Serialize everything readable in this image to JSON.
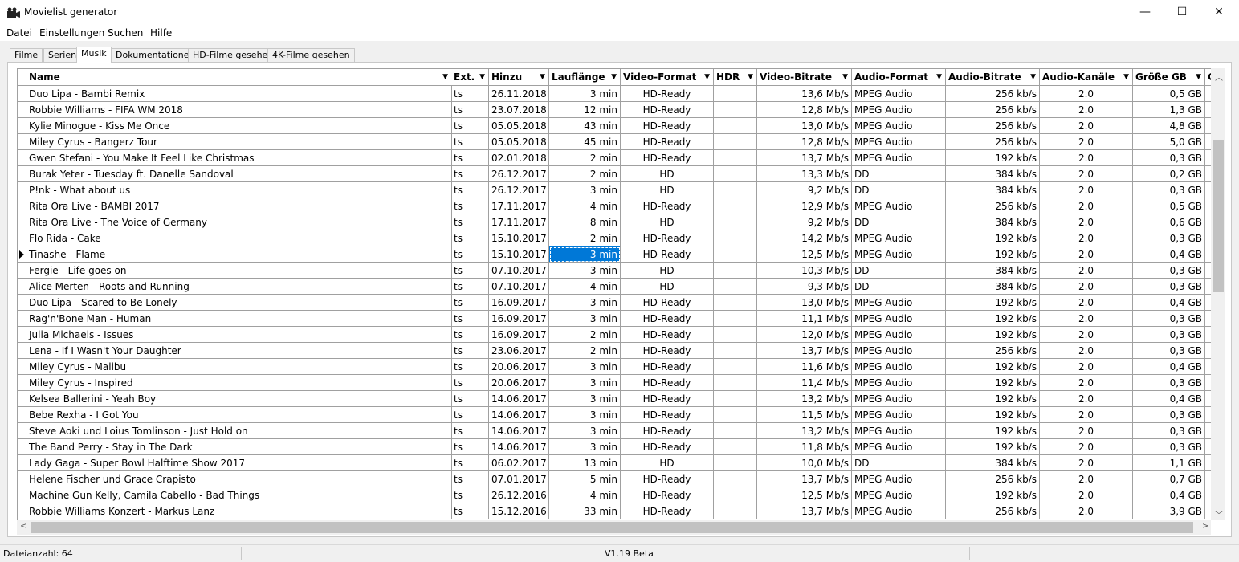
{
  "window": {
    "title": "Movielist generator",
    "minimize": "—",
    "maximize": "☐",
    "close": "✕"
  },
  "menu": [
    "Datei",
    "Einstellungen",
    "Suchen",
    "Hilfe"
  ],
  "tabs": [
    "Filme",
    "Serien",
    "Musik",
    "Dokumentationen",
    "HD-Filme gesehen",
    "4K-Filme gesehen"
  ],
  "active_tab": "Musik",
  "grid": {
    "columns": [
      "Name",
      "Ext.",
      "Hinzu",
      "Lauflänge",
      "Video-Format",
      "HDR",
      "Video-Bitrate",
      "Audio-Format",
      "Audio-Bitrate",
      "Audio-Kanäle",
      "Größe GB",
      "G"
    ],
    "rows": [
      [
        "Duo Lipa - Bambi Remix",
        "ts",
        "26.11.2018",
        "3 min",
        "HD-Ready",
        "",
        "13,6 Mb/s",
        "MPEG Audio",
        "256 kb/s",
        "2.0",
        "0,5 GB"
      ],
      [
        "Robbie Williams - FIFA WM 2018",
        "ts",
        "23.07.2018",
        "12 min",
        "HD-Ready",
        "",
        "12,8 Mb/s",
        "MPEG Audio",
        "256 kb/s",
        "2.0",
        "1,3 GB"
      ],
      [
        "Kylie Minogue - Kiss Me Once",
        "ts",
        "05.05.2018",
        "43 min",
        "HD-Ready",
        "",
        "13,0 Mb/s",
        "MPEG Audio",
        "256 kb/s",
        "2.0",
        "4,8 GB"
      ],
      [
        "Miley Cyrus - Bangerz Tour",
        "ts",
        "05.05.2018",
        "45 min",
        "HD-Ready",
        "",
        "12,8 Mb/s",
        "MPEG Audio",
        "256 kb/s",
        "2.0",
        "5,0 GB"
      ],
      [
        "Gwen Stefani - You Make It Feel Like Christmas",
        "ts",
        "02.01.2018",
        "2 min",
        "HD-Ready",
        "",
        "13,7 Mb/s",
        "MPEG Audio",
        "192 kb/s",
        "2.0",
        "0,3 GB"
      ],
      [
        "Burak Yeter - Tuesday ft. Danelle Sandoval",
        "ts",
        "26.12.2017",
        "2 min",
        "HD",
        "",
        "13,3 Mb/s",
        "DD",
        "384 kb/s",
        "2.0",
        "0,2 GB"
      ],
      [
        "P!nk - What about us",
        "ts",
        "26.12.2017",
        "3 min",
        "HD",
        "",
        "9,2 Mb/s",
        "DD",
        "384 kb/s",
        "2.0",
        "0,3 GB"
      ],
      [
        "Rita Ora Live - BAMBI 2017",
        "ts",
        "17.11.2017",
        "4 min",
        "HD-Ready",
        "",
        "12,9 Mb/s",
        "MPEG Audio",
        "256 kb/s",
        "2.0",
        "0,5 GB"
      ],
      [
        "Rita Ora Live - The Voice of Germany",
        "ts",
        "17.11.2017",
        "8 min",
        "HD",
        "",
        "9,2 Mb/s",
        "DD",
        "384 kb/s",
        "2.0",
        "0,6 GB"
      ],
      [
        "Flo Rida - Cake",
        "ts",
        "15.10.2017",
        "2 min",
        "HD-Ready",
        "",
        "14,2 Mb/s",
        "MPEG Audio",
        "192 kb/s",
        "2.0",
        "0,3 GB"
      ],
      [
        "Tinashe - Flame",
        "ts",
        "15.10.2017",
        "3 min",
        "HD-Ready",
        "",
        "12,5 Mb/s",
        "MPEG Audio",
        "192 kb/s",
        "2.0",
        "0,4 GB"
      ],
      [
        "Fergie - Life goes on",
        "ts",
        "07.10.2017",
        "3 min",
        "HD",
        "",
        "10,3 Mb/s",
        "DD",
        "384 kb/s",
        "2.0",
        "0,3 GB"
      ],
      [
        "Alice Merten - Roots and Running",
        "ts",
        "07.10.2017",
        "4 min",
        "HD",
        "",
        "9,3 Mb/s",
        "DD",
        "384 kb/s",
        "2.0",
        "0,3 GB"
      ],
      [
        "Duo Lipa - Scared to Be Lonely",
        "ts",
        "16.09.2017",
        "3 min",
        "HD-Ready",
        "",
        "13,0 Mb/s",
        "MPEG Audio",
        "192 kb/s",
        "2.0",
        "0,4 GB"
      ],
      [
        "Rag'n'Bone Man - Human",
        "ts",
        "16.09.2017",
        "3 min",
        "HD-Ready",
        "",
        "11,1 Mb/s",
        "MPEG Audio",
        "192 kb/s",
        "2.0",
        "0,3 GB"
      ],
      [
        "Julia Michaels - Issues",
        "ts",
        "16.09.2017",
        "2 min",
        "HD-Ready",
        "",
        "12,0 Mb/s",
        "MPEG Audio",
        "192 kb/s",
        "2.0",
        "0,3 GB"
      ],
      [
        "Lena - If I Wasn't Your Daughter",
        "ts",
        "23.06.2017",
        "2 min",
        "HD-Ready",
        "",
        "13,7 Mb/s",
        "MPEG Audio",
        "256 kb/s",
        "2.0",
        "0,3 GB"
      ],
      [
        "Miley Cyrus - Malibu",
        "ts",
        "20.06.2017",
        "3 min",
        "HD-Ready",
        "",
        "11,6 Mb/s",
        "MPEG Audio",
        "192 kb/s",
        "2.0",
        "0,4 GB"
      ],
      [
        "Miley Cyrus - Inspired",
        "ts",
        "20.06.2017",
        "3 min",
        "HD-Ready",
        "",
        "11,4 Mb/s",
        "MPEG Audio",
        "192 kb/s",
        "2.0",
        "0,3 GB"
      ],
      [
        "Kelsea Ballerini - Yeah Boy",
        "ts",
        "14.06.2017",
        "3 min",
        "HD-Ready",
        "",
        "13,2 Mb/s",
        "MPEG Audio",
        "192 kb/s",
        "2.0",
        "0,4 GB"
      ],
      [
        "Bebe Rexha - I Got You",
        "ts",
        "14.06.2017",
        "3 min",
        "HD-Ready",
        "",
        "11,5 Mb/s",
        "MPEG Audio",
        "192 kb/s",
        "2.0",
        "0,3 GB"
      ],
      [
        "Steve Aoki und Loius Tomlinson - Just Hold on",
        "ts",
        "14.06.2017",
        "3 min",
        "HD-Ready",
        "",
        "13,2 Mb/s",
        "MPEG Audio",
        "192 kb/s",
        "2.0",
        "0,3 GB"
      ],
      [
        "The Band Perry - Stay in The Dark",
        "ts",
        "14.06.2017",
        "3 min",
        "HD-Ready",
        "",
        "11,8 Mb/s",
        "MPEG Audio",
        "192 kb/s",
        "2.0",
        "0,3 GB"
      ],
      [
        "Lady Gaga - Super Bowl Halftime Show 2017",
        "ts",
        "06.02.2017",
        "13 min",
        "HD",
        "",
        "10,0 Mb/s",
        "DD",
        "384 kb/s",
        "2.0",
        "1,1 GB"
      ],
      [
        "Helene Fischer und Grace Crapisto",
        "ts",
        "07.01.2017",
        "5 min",
        "HD-Ready",
        "",
        "13,7 Mb/s",
        "MPEG Audio",
        "256 kb/s",
        "2.0",
        "0,7 GB"
      ],
      [
        "Machine Gun Kelly, Camila Cabello - Bad Things",
        "ts",
        "26.12.2016",
        "4 min",
        "HD-Ready",
        "",
        "12,5 Mb/s",
        "MPEG Audio",
        "192 kb/s",
        "2.0",
        "0,4 GB"
      ],
      [
        "Robbie Williams Konzert - Markus Lanz",
        "ts",
        "15.12.2016",
        "33 min",
        "HD-Ready",
        "",
        "13,7 Mb/s",
        "MPEG Audio",
        "256 kb/s",
        "2.0",
        "3,9 GB"
      ]
    ],
    "current_row": 10,
    "selected_column": 3
  },
  "status": {
    "file_count": "Dateianzahl: 64",
    "version": "V1.19 Beta"
  }
}
